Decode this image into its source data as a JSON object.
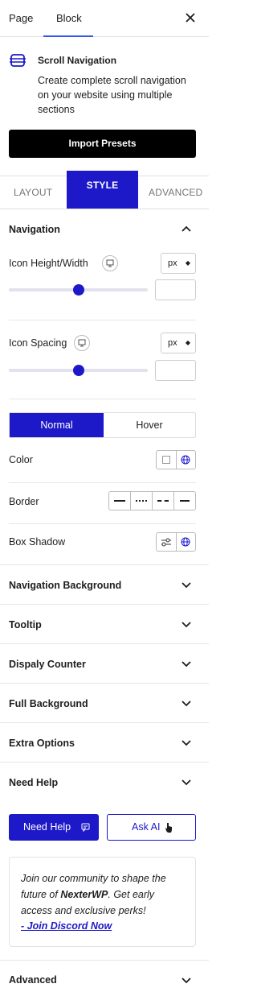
{
  "tabs": [
    {
      "label": "Page"
    },
    {
      "label": "Block"
    }
  ],
  "block": {
    "title": "Scroll Navigation",
    "description": "Create complete scroll navigation on your website using multiple sections",
    "import_label": "Import Presets"
  },
  "style_tabs": [
    {
      "label": "LAYOUT"
    },
    {
      "label": "STYLE"
    },
    {
      "label": "ADVANCED"
    }
  ],
  "navigation": {
    "heading": "Navigation",
    "icon_size": {
      "label": "Icon Height/Width",
      "unit": "px",
      "value": "",
      "slider_fraction": 0.5
    },
    "icon_spacing": {
      "label": "Icon Spacing",
      "unit": "px",
      "value": "",
      "slider_fraction": 0.5
    },
    "state_tabs": [
      {
        "label": "Normal"
      },
      {
        "label": "Hover"
      }
    ],
    "color_label": "Color",
    "border_label": "Border",
    "box_shadow_label": "Box Shadow"
  },
  "accordions": [
    {
      "label": "Navigation Background"
    },
    {
      "label": "Tooltip"
    },
    {
      "label": "Dispaly Counter"
    },
    {
      "label": "Full Background"
    },
    {
      "label": "Extra Options"
    },
    {
      "label": "Need Help"
    }
  ],
  "help": {
    "need_help_label": "Need Help",
    "ask_ai_label": "Ask AI",
    "community_text_1": "Join our community to shape the future of ",
    "brand": "NexterWP",
    "community_text_2": ". Get early access and exclusive perks!",
    "discord_link": "- Join Discord Now"
  },
  "advanced_label": "Advanced",
  "colors": {
    "accent": "#1d18c8",
    "wp_blue": "#3858e9"
  }
}
